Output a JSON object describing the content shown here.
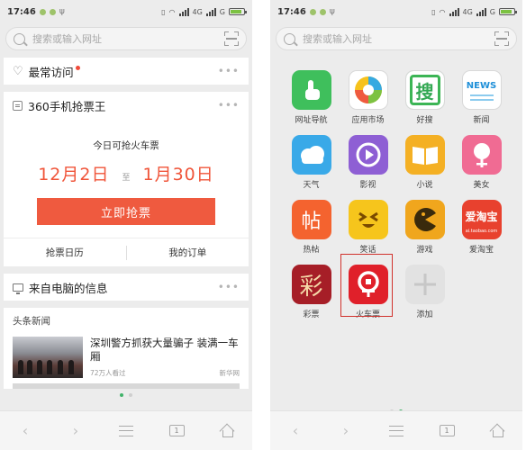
{
  "status_bar": {
    "time": "17:46",
    "network_label": "4G",
    "carrier_label": "G"
  },
  "search": {
    "placeholder": "搜索或输入网址"
  },
  "left": {
    "frequent": {
      "title": "最常访问"
    },
    "ticket": {
      "title": "360手机抢票王",
      "subtitle": "今日可抢火车票",
      "date_start": "12月2日",
      "date_to": "至",
      "date_end": "1月30日",
      "button": "立即抢票",
      "links": [
        "抢票日历",
        "我的订单"
      ]
    },
    "pc_info": {
      "title": "来自电脑的信息"
    },
    "news": {
      "header": "头条新闻",
      "item": {
        "title": "深圳警方抓获大量骗子 装满一车厢",
        "views": "72万人看过",
        "source": "新华网"
      }
    }
  },
  "right": {
    "apps": [
      {
        "label": "网址导航",
        "color": "#3fbf5c",
        "icon": "hand-pointer-icon"
      },
      {
        "label": "应用市场",
        "color": "#ffffff",
        "icon": "app-market-icon"
      },
      {
        "label": "好搜",
        "color": "#ffffff",
        "icon": "search-sou-icon",
        "glyph": "搜"
      },
      {
        "label": "新闻",
        "color": "#ffffff",
        "icon": "news-icon",
        "glyph": "NEWS"
      },
      {
        "label": "天气",
        "color": "#39a9e8",
        "icon": "weather-cloud-icon"
      },
      {
        "label": "影视",
        "color": "#8e5fd4",
        "icon": "video-play-icon"
      },
      {
        "label": "小说",
        "color": "#f4b024",
        "icon": "book-icon"
      },
      {
        "label": "美女",
        "color": "#f06b93",
        "icon": "beauty-icon"
      },
      {
        "label": "热帖",
        "color": "#f4632f",
        "icon": "hot-post-icon",
        "glyph": "帖"
      },
      {
        "label": "笑话",
        "color": "#f6c51c",
        "icon": "joke-face-icon"
      },
      {
        "label": "游戏",
        "color": "#f0a61d",
        "icon": "game-pacman-icon"
      },
      {
        "label": "爱淘宝",
        "color": "#e8412e",
        "icon": "ai-taobao-icon",
        "glyph": "爱淘宝",
        "subglyph": "ai.taobao.com"
      },
      {
        "label": "彩票",
        "color": "#a61e27",
        "icon": "lottery-icon",
        "glyph": "彩"
      },
      {
        "label": "火车票",
        "color": "#e0202a",
        "icon": "train-ticket-icon"
      },
      {
        "label": "添加",
        "color": "#e2e2e2",
        "icon": "plus-icon"
      }
    ]
  }
}
